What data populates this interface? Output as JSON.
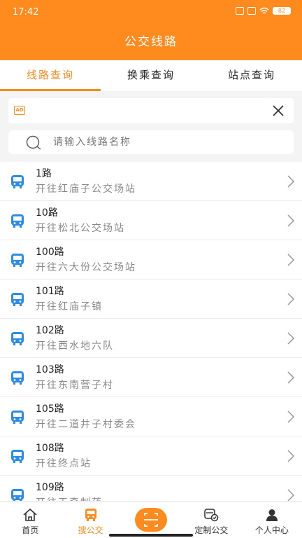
{
  "status": {
    "time": "17:42",
    "battery": "82"
  },
  "header": {
    "title": "公交线路"
  },
  "tabs": [
    {
      "label": "线路查询",
      "active": true
    },
    {
      "label": "换乘查询",
      "active": false
    },
    {
      "label": "站点查询",
      "active": false
    }
  ],
  "ad": {
    "badge": "AD"
  },
  "search": {
    "placeholder": "请输入线路名称",
    "value": ""
  },
  "routes": [
    {
      "name": "1路",
      "dest": "开往红庙子公交场站"
    },
    {
      "name": "10路",
      "dest": "开往松北公交场站"
    },
    {
      "name": "100路",
      "dest": "开往六大份公交场站"
    },
    {
      "name": "101路",
      "dest": "开往红庙子镇"
    },
    {
      "name": "102路",
      "dest": "开往西水地六队"
    },
    {
      "name": "103路",
      "dest": "开往东南营子村"
    },
    {
      "name": "105路",
      "dest": "开往二道井子村委会"
    },
    {
      "name": "108路",
      "dest": "开往终点站"
    },
    {
      "name": "109路",
      "dest": "开往天奇制药"
    }
  ],
  "nav": [
    {
      "label": "首页",
      "icon": "home-icon"
    },
    {
      "label": "搜公交",
      "icon": "bus-icon",
      "active": true
    },
    {
      "label": "",
      "icon": "scan-icon"
    },
    {
      "label": "定制公交",
      "icon": "custom-bus-icon"
    },
    {
      "label": "个人中心",
      "icon": "user-icon"
    }
  ],
  "colors": {
    "accent": "#ff8a1e",
    "bus_icon": "#2b8be8"
  }
}
